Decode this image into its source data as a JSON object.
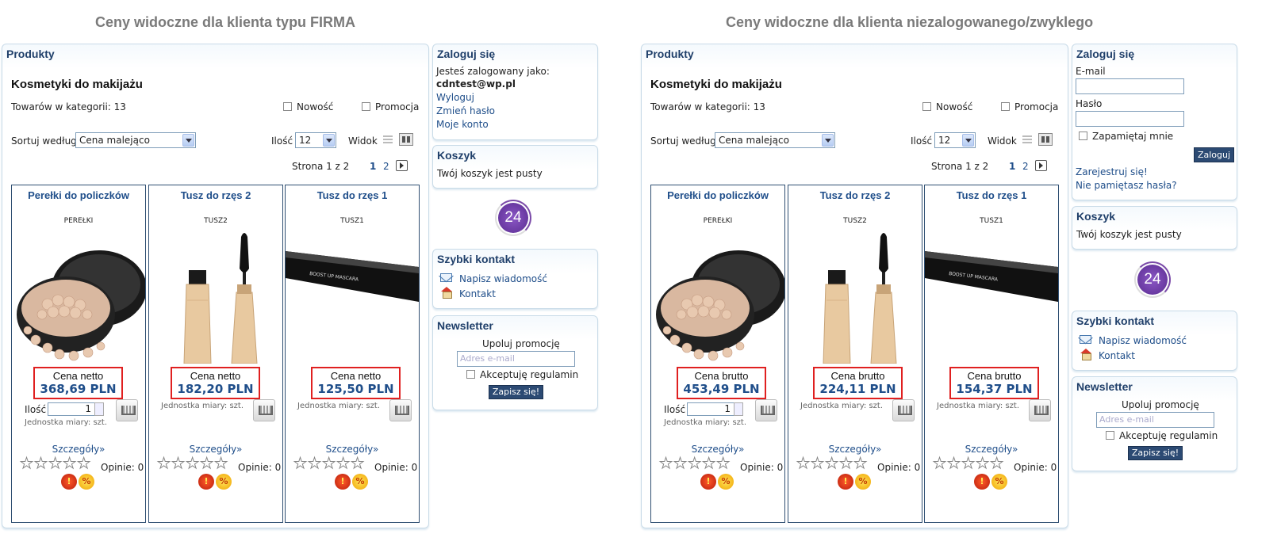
{
  "left_heading": "Ceny widoczne dla klienta typu FIRMA",
  "right_heading": "Ceny widoczne dla klienta niezalogowanego/zwyklego",
  "catalog": {
    "panel_title": "Produkty",
    "category_title": "Kosmetyki do makijażu",
    "items_in_category": "Towarów w kategorii: 13",
    "filter_new": "Nowość",
    "filter_promo": "Promocja",
    "sort_label": "Sortuj według",
    "sort_value": "Cena malejąco",
    "qty_label": "Ilość",
    "qty_value": "12",
    "view_label": "Widok",
    "page_info": "Strona 1 z 2",
    "page1": "1",
    "page2": "2",
    "details_link": "Szczegóły»",
    "opinions": "Opinie: 0",
    "qty_field_label": "Ilość",
    "qty_field_value": "1",
    "unit_text": "Jednostka miary: szt."
  },
  "products": [
    {
      "name": "Perełki do policzków",
      "code": "PEREŁKI",
      "image": "pearl-powder",
      "net_label": "Cena netto",
      "net_price": "368,69 PLN",
      "gross_label": "Cena brutto",
      "gross_price": "453,49 PLN"
    },
    {
      "name": "Tusz do rzęs 2",
      "code": "TUSZ2",
      "image": "mascara-gold",
      "net_label": "Cena netto",
      "net_price": "182,20 PLN",
      "gross_label": "Cena brutto",
      "gross_price": "224,11 PLN"
    },
    {
      "name": "Tusz do rzęs 1",
      "code": "TUSZ1",
      "image": "mascara-black",
      "net_label": "Cena netto",
      "net_price": "125,50 PLN",
      "gross_label": "Cena brutto",
      "gross_price": "154,37 PLN"
    }
  ],
  "mascara_text": "BOOST UP MASCARA",
  "login_logged": {
    "title": "Zaloguj się",
    "logged_as": "Jesteś zalogowany jako:",
    "user": "cdntest@wp.pl",
    "logout": "Wyloguj",
    "change_password": "Zmień hasło",
    "my_account": "Moje konto"
  },
  "login_form": {
    "title": "Zaloguj się",
    "email_label": "E-mail",
    "password_label": "Hasło",
    "remember": "Zapamiętaj mnie",
    "login_button": "Zaloguj",
    "register": "Zarejestruj się!",
    "forgot": "Nie pamiętasz hasła?"
  },
  "cart": {
    "title": "Koszyk",
    "empty": "Twój koszyk jest pusty"
  },
  "badge_24": "24",
  "quick_contact": {
    "title": "Szybki kontakt",
    "write": "Napisz wiadomość",
    "contact": "Kontakt"
  },
  "newsletter": {
    "title": "Newsletter",
    "tagline": "Upoluj promocję",
    "email_placeholder": "Adres e-mail",
    "accept": "Akceptuję regulamin",
    "subscribe": "Zapisz się!"
  },
  "colors": {
    "accent": "#1f4e8a",
    "price_border": "#e02020",
    "button": "#2c4a73",
    "badge_purple": "#6a3aa2"
  }
}
